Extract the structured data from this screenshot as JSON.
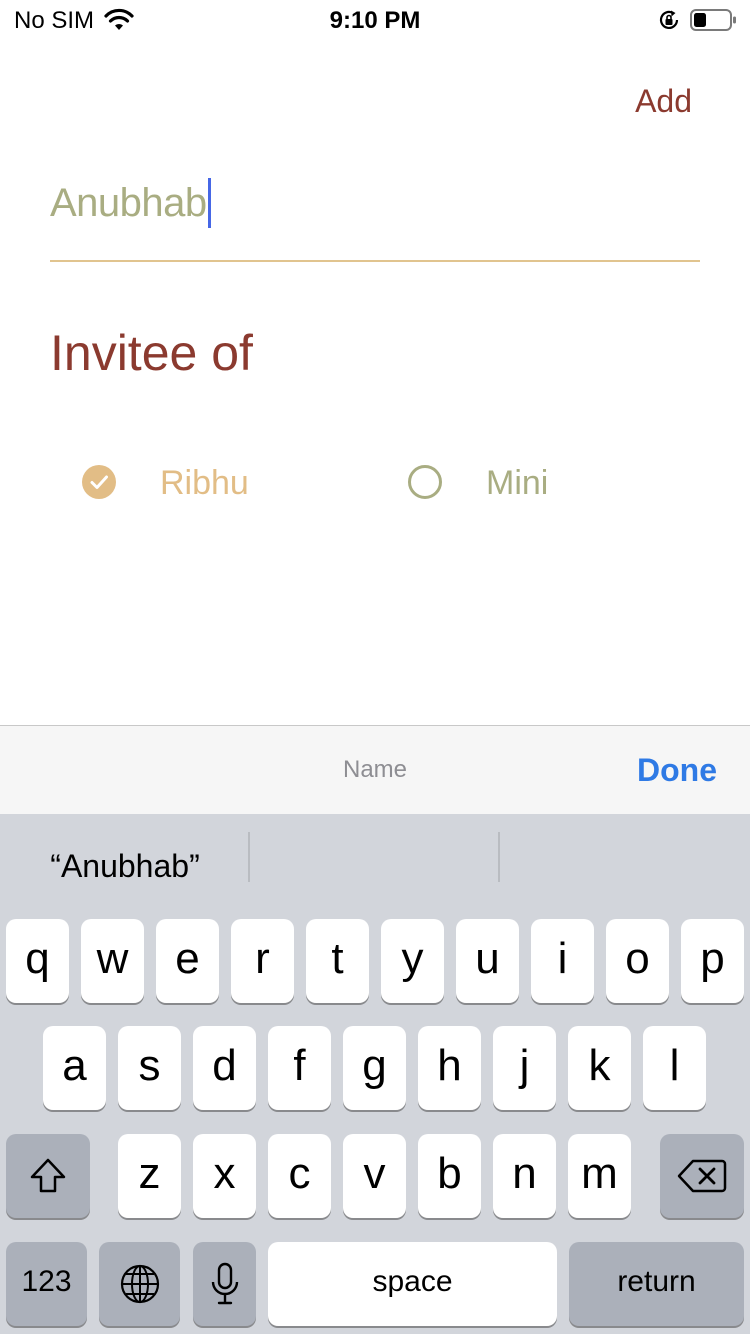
{
  "status_bar": {
    "carrier": "No SIM",
    "time": "9:10 PM",
    "battery_level": 0.35
  },
  "form": {
    "add_label": "Add",
    "name_value": "Anubhab",
    "section_title": "Invitee of",
    "options": [
      {
        "label": "Ribhu",
        "selected": true
      },
      {
        "label": "Mini",
        "selected": false
      }
    ]
  },
  "accessory_bar": {
    "field_title": "Name",
    "done_label": "Done"
  },
  "keyboard": {
    "suggestions": [
      "“Anubhab”",
      "",
      ""
    ],
    "row1": [
      "q",
      "w",
      "e",
      "r",
      "t",
      "y",
      "u",
      "i",
      "o",
      "p"
    ],
    "row2": [
      "a",
      "s",
      "d",
      "f",
      "g",
      "h",
      "j",
      "k",
      "l"
    ],
    "row3": [
      "z",
      "x",
      "c",
      "v",
      "b",
      "n",
      "m"
    ],
    "numbers_label": "123",
    "space_label": "space",
    "return_label": "return",
    "icons": {
      "shift": "shift-icon",
      "backspace": "backspace-icon",
      "globe": "globe-icon",
      "mic": "microphone-icon"
    }
  },
  "colors": {
    "accent_red": "#8b3a2f",
    "accent_gold": "#e2bd86",
    "accent_olive": "#a9ad82",
    "caret_blue": "#4667e6",
    "done_blue": "#2f7ae5"
  }
}
